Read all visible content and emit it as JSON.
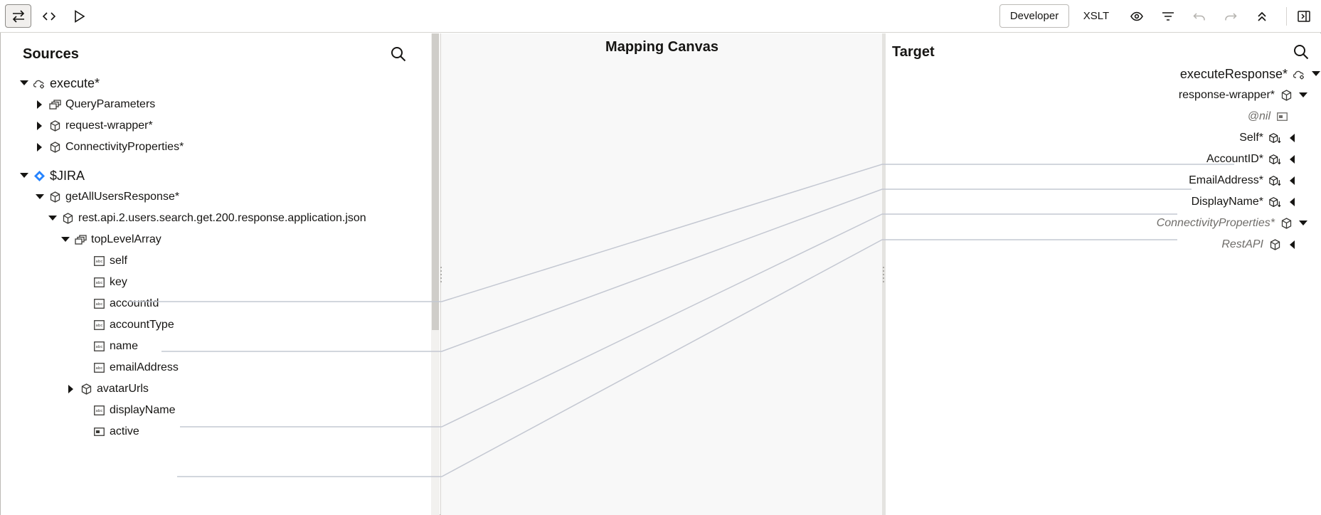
{
  "toolbar": {
    "developer_label": "Developer",
    "xslt_label": "XSLT"
  },
  "sources": {
    "title": "Sources",
    "items": [
      {
        "label": "execute",
        "req": "*",
        "icon": "cloud-gear-icon"
      },
      {
        "label": "QueryParameters",
        "req": "",
        "icon": "collection-icon"
      },
      {
        "label": "request-wrapper",
        "req": "*",
        "icon": "cube-icon"
      },
      {
        "label": "ConnectivityProperties",
        "req": "*",
        "icon": "cube-icon"
      },
      {
        "label": "$JIRA",
        "req": "",
        "icon": "jira-diamond-icon"
      },
      {
        "label": "getAllUsersResponse",
        "req": "*",
        "icon": "cube-icon"
      },
      {
        "label": "rest.api.2.users.search.get.200.response.application.json",
        "req": "",
        "icon": "cube-icon"
      },
      {
        "label": "topLevelArray",
        "req": "",
        "icon": "collection-icon"
      },
      {
        "label": "self",
        "req": "",
        "icon": "string-field-icon"
      },
      {
        "label": "key",
        "req": "",
        "icon": "string-field-icon"
      },
      {
        "label": "accountId",
        "req": "",
        "icon": "string-field-icon"
      },
      {
        "label": "accountType",
        "req": "",
        "icon": "string-field-icon"
      },
      {
        "label": "name",
        "req": "",
        "icon": "string-field-icon"
      },
      {
        "label": "emailAddress",
        "req": "",
        "icon": "string-field-icon"
      },
      {
        "label": "avatarUrls",
        "req": "",
        "icon": "cube-icon"
      },
      {
        "label": "displayName",
        "req": "",
        "icon": "string-field-icon"
      },
      {
        "label": "active",
        "req": "",
        "icon": "boolean-field-icon"
      }
    ]
  },
  "canvas": {
    "title": "Mapping Canvas"
  },
  "target": {
    "title": "Target",
    "items": [
      {
        "label": "executeResponse",
        "req": "*",
        "icon": "cloud-gear-icon"
      },
      {
        "label": "response-wrapper",
        "req": "*",
        "icon": "cube-icon"
      },
      {
        "label": "@nil",
        "req": "",
        "icon": "attribute-icon"
      },
      {
        "label": "Self",
        "req": "*",
        "icon": "mapped-cube-icon"
      },
      {
        "label": "AccountID",
        "req": "*",
        "icon": "mapped-cube-icon"
      },
      {
        "label": "EmailAddress",
        "req": "*",
        "icon": "mapped-cube-icon"
      },
      {
        "label": "DisplayName",
        "req": "*",
        "icon": "mapped-cube-icon"
      },
      {
        "label": "ConnectivityProperties",
        "req": "*",
        "icon": "cube-icon"
      },
      {
        "label": "RestAPI",
        "req": "",
        "icon": "cube-icon"
      }
    ]
  },
  "colors": {
    "connector": "#c4c8d2",
    "jira_blue": "#2684ff",
    "canvas_bg": "#f8f8f8"
  }
}
